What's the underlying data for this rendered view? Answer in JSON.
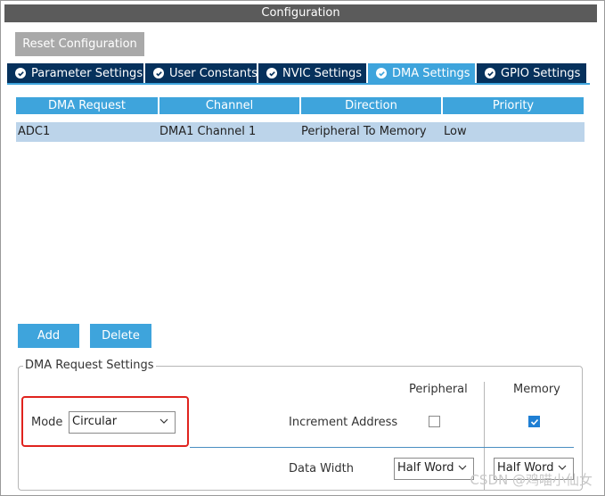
{
  "window": {
    "title": "Configuration"
  },
  "toolbar": {
    "reset_label": "Reset Configuration"
  },
  "tabs": [
    {
      "label": "Parameter Settings",
      "active": false
    },
    {
      "label": "User Constants",
      "active": false
    },
    {
      "label": "NVIC Settings",
      "active": false
    },
    {
      "label": "DMA Settings",
      "active": true
    },
    {
      "label": "GPIO Settings",
      "active": false
    }
  ],
  "table": {
    "headers": [
      "DMA Request",
      "Channel",
      "Direction",
      "Priority"
    ],
    "rows": [
      {
        "request": "ADC1",
        "channel": "DMA1 Channel 1",
        "direction": "Peripheral To Memory",
        "priority": "Low"
      }
    ]
  },
  "actions": {
    "add_label": "Add",
    "delete_label": "Delete"
  },
  "settings": {
    "group_title": "DMA Request Settings",
    "mode_label": "Mode",
    "mode_value": "Circular",
    "peripheral_header": "Peripheral",
    "memory_header": "Memory",
    "increment_label": "Increment Address",
    "increment_peripheral": false,
    "increment_memory": true,
    "data_width_label": "Data Width",
    "data_width_peripheral": "Half Word",
    "data_width_memory": "Half Word"
  },
  "watermark": "CSDN @鸡喵小仙女",
  "colors": {
    "tab_active": "#3ea4dc",
    "tab_inactive": "#06315c",
    "header": "#3ea4dc",
    "selected_row": "#bcd4ea",
    "highlight": "#e0231e"
  }
}
